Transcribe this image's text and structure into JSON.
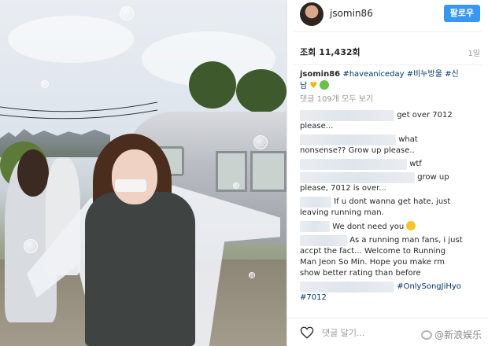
{
  "post": {
    "username": "jsomin86",
    "follow_label": "팔로우",
    "views": "조회 11,432회",
    "date": "1일"
  },
  "caption": {
    "username": "jsomin86",
    "text_1": "#haveaniceday",
    "text_2": "#비누방울",
    "text_3": "#신",
    "text_4": "남",
    "view_all": "댓글 109개 모두 보기"
  },
  "comments": [
    {
      "l1": "get over 7012",
      "l2": "please..."
    },
    {
      "l1": "what",
      "l2": "nonsense?? Grow up please.."
    },
    {
      "l1": "wtf"
    },
    {
      "l1": "grow up",
      "l2": "please, 7012 is over..."
    },
    {
      "l1": "If u dont wanna get hate, just",
      "l2": "leaving running man."
    },
    {
      "l1": "We dont need you"
    },
    {
      "l1": "As a running man fans, i just",
      "l2": "accpt the fact... Welcome to Running",
      "l3": "Man Jeon So Min. Hope you make rm",
      "l4": "show better rating than before"
    },
    {
      "l1": "#OnlySongJiHyo",
      "l2": "#7012"
    }
  ],
  "footer": {
    "add_comment": "댓글 달기...",
    "watermark": "@新浪娱乐"
  },
  "colors": {
    "follow_button": "#3897f0",
    "hashtag": "#003569",
    "muted": "#999999"
  },
  "icons": [
    "heart-icon",
    "weibo-logo-icon"
  ]
}
